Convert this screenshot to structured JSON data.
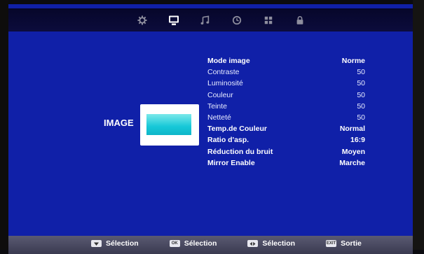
{
  "top_tabs": [
    {
      "icon": "gear-icon",
      "active": false
    },
    {
      "icon": "monitor-icon",
      "active": true
    },
    {
      "icon": "music-note-icon",
      "active": false
    },
    {
      "icon": "clock-icon",
      "active": false
    },
    {
      "icon": "grid-icon",
      "active": false
    },
    {
      "icon": "lock-icon",
      "active": false
    }
  ],
  "page": {
    "title": "IMAGE"
  },
  "menu": {
    "items": [
      {
        "label": "Mode image",
        "value": "Norme"
      },
      {
        "label": "Contraste",
        "value": "50"
      },
      {
        "label": "Luminosité",
        "value": "50"
      },
      {
        "label": "Couleur",
        "value": "50"
      },
      {
        "label": "Teinte",
        "value": "50"
      },
      {
        "label": "Netteté",
        "value": "50"
      },
      {
        "label": "Temp.de Couleur",
        "value": "Normal"
      },
      {
        "label": "Ratio d'asp.",
        "value": "16:9"
      },
      {
        "label": "Réduction du bruit",
        "value": "Moyen"
      },
      {
        "label": "Mirror Enable",
        "value": "Marche"
      }
    ]
  },
  "bottom_hints": [
    {
      "key": "down-arrow-key-icon",
      "label": "Sélection"
    },
    {
      "key": "ok-key-icon",
      "key_text": "OK",
      "label": "Sélection"
    },
    {
      "key": "left-right-arrow-key-icon",
      "label": "Sélection"
    },
    {
      "key": "exit-key-icon",
      "key_text": "EXIT",
      "label": "Sortie"
    }
  ],
  "colors": {
    "background": "#1020a8",
    "topbar": "#0a0a36",
    "bottombar": "#4a4a62",
    "thumbnail_fill": "#16c8d8",
    "text": "#ffffff"
  }
}
